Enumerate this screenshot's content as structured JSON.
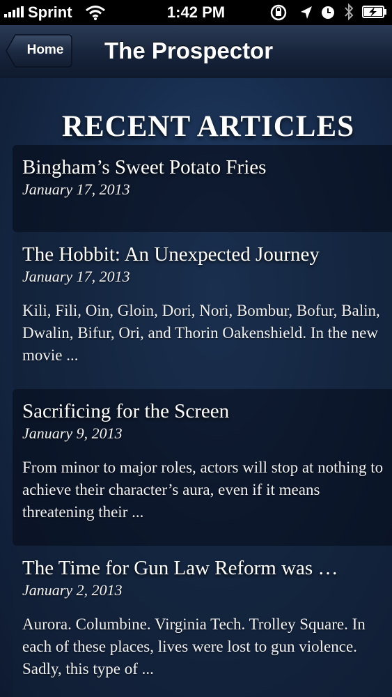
{
  "status_bar": {
    "carrier": "Sprint",
    "time": "1:42 PM"
  },
  "nav": {
    "back_label": "Home",
    "title": "The Prospector"
  },
  "section_heading": "RECENT ARTICLES",
  "articles": [
    {
      "title": "Bingham’s Sweet Potato Fries",
      "date": "January 17, 2013",
      "excerpt": ""
    },
    {
      "title": "The Hobbit: An Unexpected Journey",
      "date": "January 17, 2013",
      "excerpt": "Kili, Fili, Oin, Gloin, Dori, Nori, Bombur, Bofur, Balin, Dwalin, Bifur, Ori, and Thorin Oakenshield. In the new movie ..."
    },
    {
      "title": "Sacrificing for the Screen",
      "date": "January 9, 2013",
      "excerpt": "From minor to major roles, actors will stop at nothing to achieve their character’s aura, even if it means threatening their ..."
    },
    {
      "title": "The Time for Gun Law Reform was …",
      "date": "January 2, 2013",
      "excerpt": "Aurora. Columbine. Virginia Tech. Trolley Square. In each of these places, lives were lost to gun violence. Sadly, this type of ..."
    }
  ],
  "colors": {
    "background": "#172c4c",
    "navbar": "#16233a",
    "text": "#ffffff"
  },
  "icons": [
    "signal-strength-icon",
    "wifi-icon",
    "rotation-lock-icon",
    "location-arrow-icon",
    "alarm-clock-icon",
    "bluetooth-icon",
    "battery-charging-icon"
  ]
}
